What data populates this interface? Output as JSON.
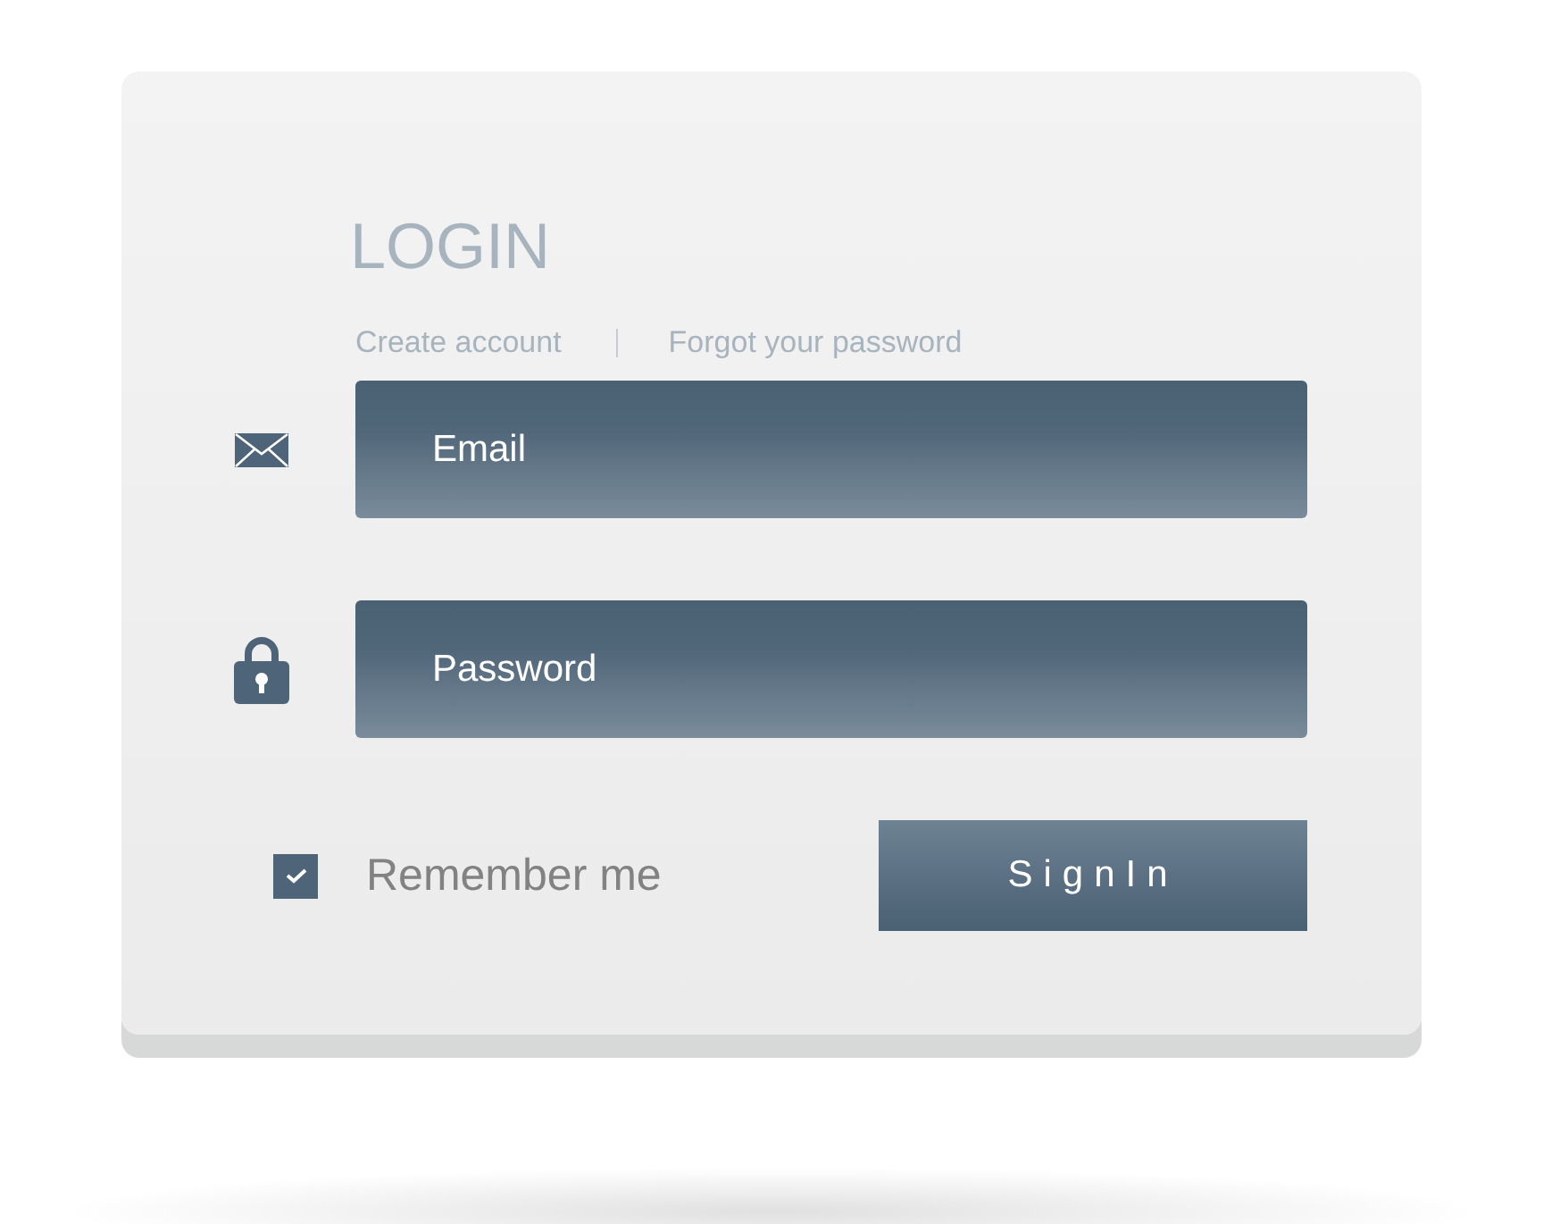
{
  "title": "LOGIN",
  "links": [
    {
      "label": "Create account"
    },
    {
      "label": "Forgot your password"
    }
  ],
  "fields": [
    {
      "kind": "email",
      "placeholder": "Email"
    },
    {
      "kind": "password",
      "placeholder": "Password"
    }
  ],
  "remember": {
    "label": "Remember me",
    "checked": true
  },
  "submit": "SignIn"
}
